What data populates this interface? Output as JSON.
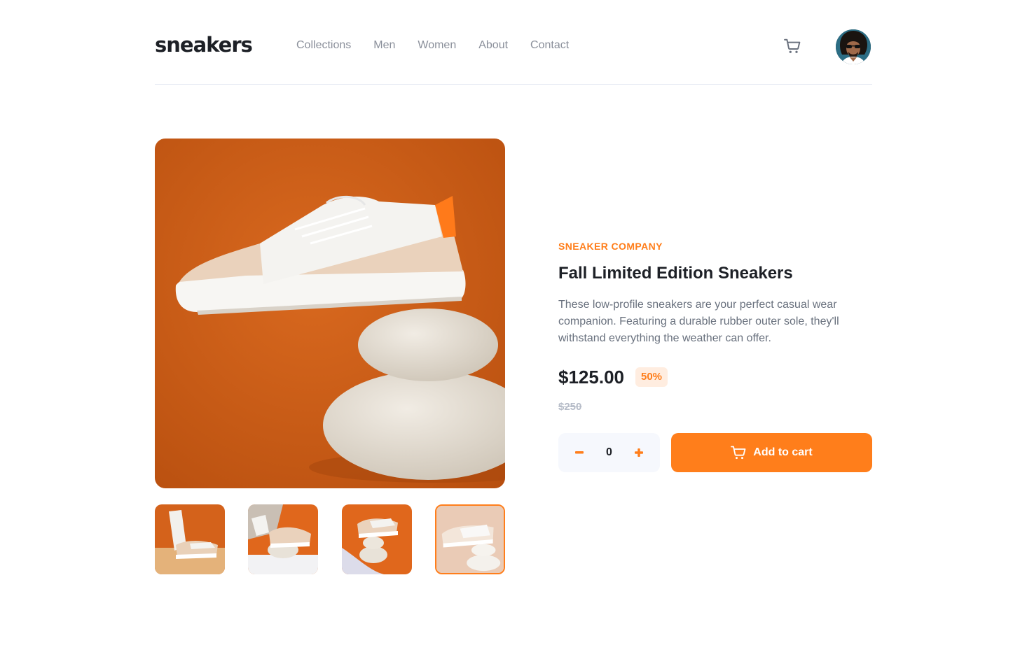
{
  "header": {
    "logo": "sneakers",
    "nav": [
      "Collections",
      "Men",
      "Women",
      "About",
      "Contact"
    ],
    "cart_icon": "cart-icon",
    "avatar_icon": "avatar"
  },
  "product": {
    "company": "SNEAKER COMPANY",
    "title": "Fall Limited Edition Sneakers",
    "description": "These low-profile sneakers are your perfect casual wear companion. Featuring a durable rubber outer sole, they'll withstand everything the weather can offer.",
    "price": "$125.00",
    "discount": "50%",
    "old_price": "$250",
    "quantity": "0",
    "add_to_cart": "Add to cart"
  },
  "gallery": {
    "thumbnails": 4,
    "active_thumbnail": 4
  },
  "colors": {
    "accent": "#ff7e1b",
    "accent_light": "#ffede0",
    "text_dark": "#1d2026",
    "text_gray": "#68707d",
    "nav_gray": "#8a8f9a",
    "product_bg": "#d2621a"
  }
}
